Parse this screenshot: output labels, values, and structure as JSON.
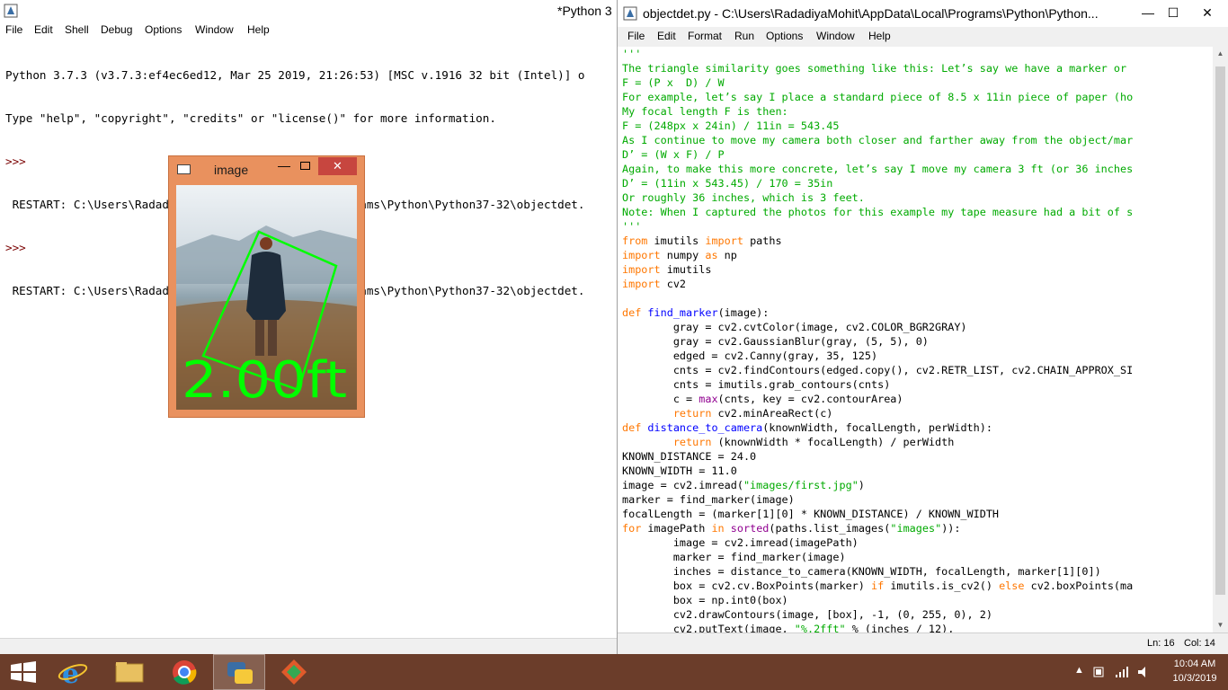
{
  "shell": {
    "title": "*Python 3",
    "menu": [
      "File",
      "Edit",
      "Shell",
      "Debug",
      "Options",
      "Window",
      "Help"
    ],
    "lines": [
      "Python 3.7.3 (v3.7.3:ef4ec6ed12, Mar 25 2019, 21:26:53) [MSC v.1916 32 bit (Intel)] o",
      "Type \"help\", \"copyright\", \"credits\" or \"license()\" for more information.",
      ">>> ",
      " RESTART: C:\\Users\\RadadiyaMohit\\AppData\\Local\\Programs\\Python\\Python37-32\\objectdet.",
      ">>> ",
      " RESTART: C:\\Users\\RadadiyaMohit\\AppData\\Local\\Programs\\Python\\Python37-32\\objectdet."
    ]
  },
  "editor": {
    "title": "objectdet.py - C:\\Users\\RadadiyaMohit\\AppData\\Local\\Programs\\Python\\Python...",
    "menu": [
      "File",
      "Edit",
      "Format",
      "Run",
      "Options",
      "Window",
      "Help"
    ],
    "controls": {
      "minimize": "—",
      "maximize": "☐",
      "close": "✕"
    },
    "code": [
      {
        "t": "'''",
        "c": "str"
      },
      {
        "t": "The triangle similarity goes something like this: Let’s say we have a marker or",
        "c": "str"
      },
      {
        "t": "F = (P x  D) / W",
        "c": "str"
      },
      {
        "t": "For example, let’s say I place a standard piece of 8.5 x 11in piece of paper (ho",
        "c": "str"
      },
      {
        "t": "My focal length F is then:",
        "c": "str"
      },
      {
        "t": "F = (248px x 24in) / 11in = 543.45",
        "c": "str"
      },
      {
        "t": "As I continue to move my camera both closer and farther away from the object/mar",
        "c": "str"
      },
      {
        "t": "D’ = (W x F) / P",
        "c": "str"
      },
      {
        "t": "Again, to make this more concrete, let’s say I move my camera 3 ft (or 36 inches",
        "c": "str"
      },
      {
        "t": "D’ = (11in x 543.45) / 170 = 35in",
        "c": "str"
      },
      {
        "t": "Or roughly 36 inches, which is 3 feet.",
        "c": "str"
      },
      {
        "t": "Note: When I captured the photos for this example my tape measure had a bit of s",
        "c": "str"
      },
      {
        "t": "'''",
        "c": "str"
      },
      {
        "t": "from imutils import paths",
        "c": "mix",
        "kw": [
          "from",
          "import"
        ]
      },
      {
        "t": "import numpy as np",
        "c": "mix",
        "kw": [
          "import",
          "as"
        ]
      },
      {
        "t": "import imutils",
        "c": "mix",
        "kw": [
          "import"
        ]
      },
      {
        "t": "import cv2",
        "c": "mix",
        "kw": [
          "import"
        ]
      },
      {
        "t": "",
        "c": "plain"
      },
      {
        "t": "def find_marker(image):",
        "c": "def",
        "name": "find_marker"
      },
      {
        "t": "        gray = cv2.cvtColor(image, cv2.COLOR_BGR2GRAY)",
        "c": "plain"
      },
      {
        "t": "        gray = cv2.GaussianBlur(gray, (5, 5), 0)",
        "c": "plain"
      },
      {
        "t": "        edged = cv2.Canny(gray, 35, 125)",
        "c": "plain"
      },
      {
        "t": "        cnts = cv2.findContours(edged.copy(), cv2.RETR_LIST, cv2.CHAIN_APPROX_SI",
        "c": "plain"
      },
      {
        "t": "        cnts = imutils.grab_contours(cnts)",
        "c": "plain"
      },
      {
        "t": "        c = max(cnts, key = cv2.contourArea)",
        "c": "bi",
        "bi": "max"
      },
      {
        "t": "        return cv2.minAreaRect(c)",
        "c": "mix",
        "kw": [
          "return"
        ]
      },
      {
        "t": "def distance_to_camera(knownWidth, focalLength, perWidth):",
        "c": "def",
        "name": "distance_to_camera"
      },
      {
        "t": "        return (knownWidth * focalLength) / perWidth",
        "c": "mix",
        "kw": [
          "return"
        ]
      },
      {
        "t": "KNOWN_DISTANCE = 24.0",
        "c": "plain"
      },
      {
        "t": "KNOWN_WIDTH = 11.0",
        "c": "plain"
      },
      {
        "t": "image = cv2.imread(\"images/first.jpg\")",
        "c": "strpart",
        "s": "\"images/first.jpg\""
      },
      {
        "t": "marker = find_marker(image)",
        "c": "plain"
      },
      {
        "t": "focalLength = (marker[1][0] * KNOWN_DISTANCE) / KNOWN_WIDTH",
        "c": "plain"
      },
      {
        "t": "for imagePath in sorted(paths.list_images(\"images\")):",
        "c": "for"
      },
      {
        "t": "        image = cv2.imread(imagePath)",
        "c": "plain"
      },
      {
        "t": "        marker = find_marker(image)",
        "c": "plain"
      },
      {
        "t": "        inches = distance_to_camera(KNOWN_WIDTH, focalLength, marker[1][0])",
        "c": "plain"
      },
      {
        "t": "        box = cv2.cv.BoxPoints(marker) if imutils.is_cv2() else cv2.boxPoints(ma",
        "c": "mix",
        "kw": [
          "if",
          "else"
        ]
      },
      {
        "t": "        box = np.int0(box)",
        "c": "plain"
      },
      {
        "t": "        cv2.drawContours(image, [box], -1, (0, 255, 0), 2)",
        "c": "plain"
      },
      {
        "t": "        cv2.putText(image, \"%.2fft\" % (inches / 12),",
        "c": "strpart",
        "s": "\"%.2fft\""
      }
    ],
    "status": {
      "line": "Ln: 16",
      "col": "Col: 14"
    }
  },
  "image_window": {
    "title": "image",
    "overlay_text": "2.00ft",
    "box_color": "#00ff00"
  },
  "taskbar": {
    "time": "10:04 AM",
    "date": "10/3/2019",
    "color": "#6b3d2a"
  }
}
